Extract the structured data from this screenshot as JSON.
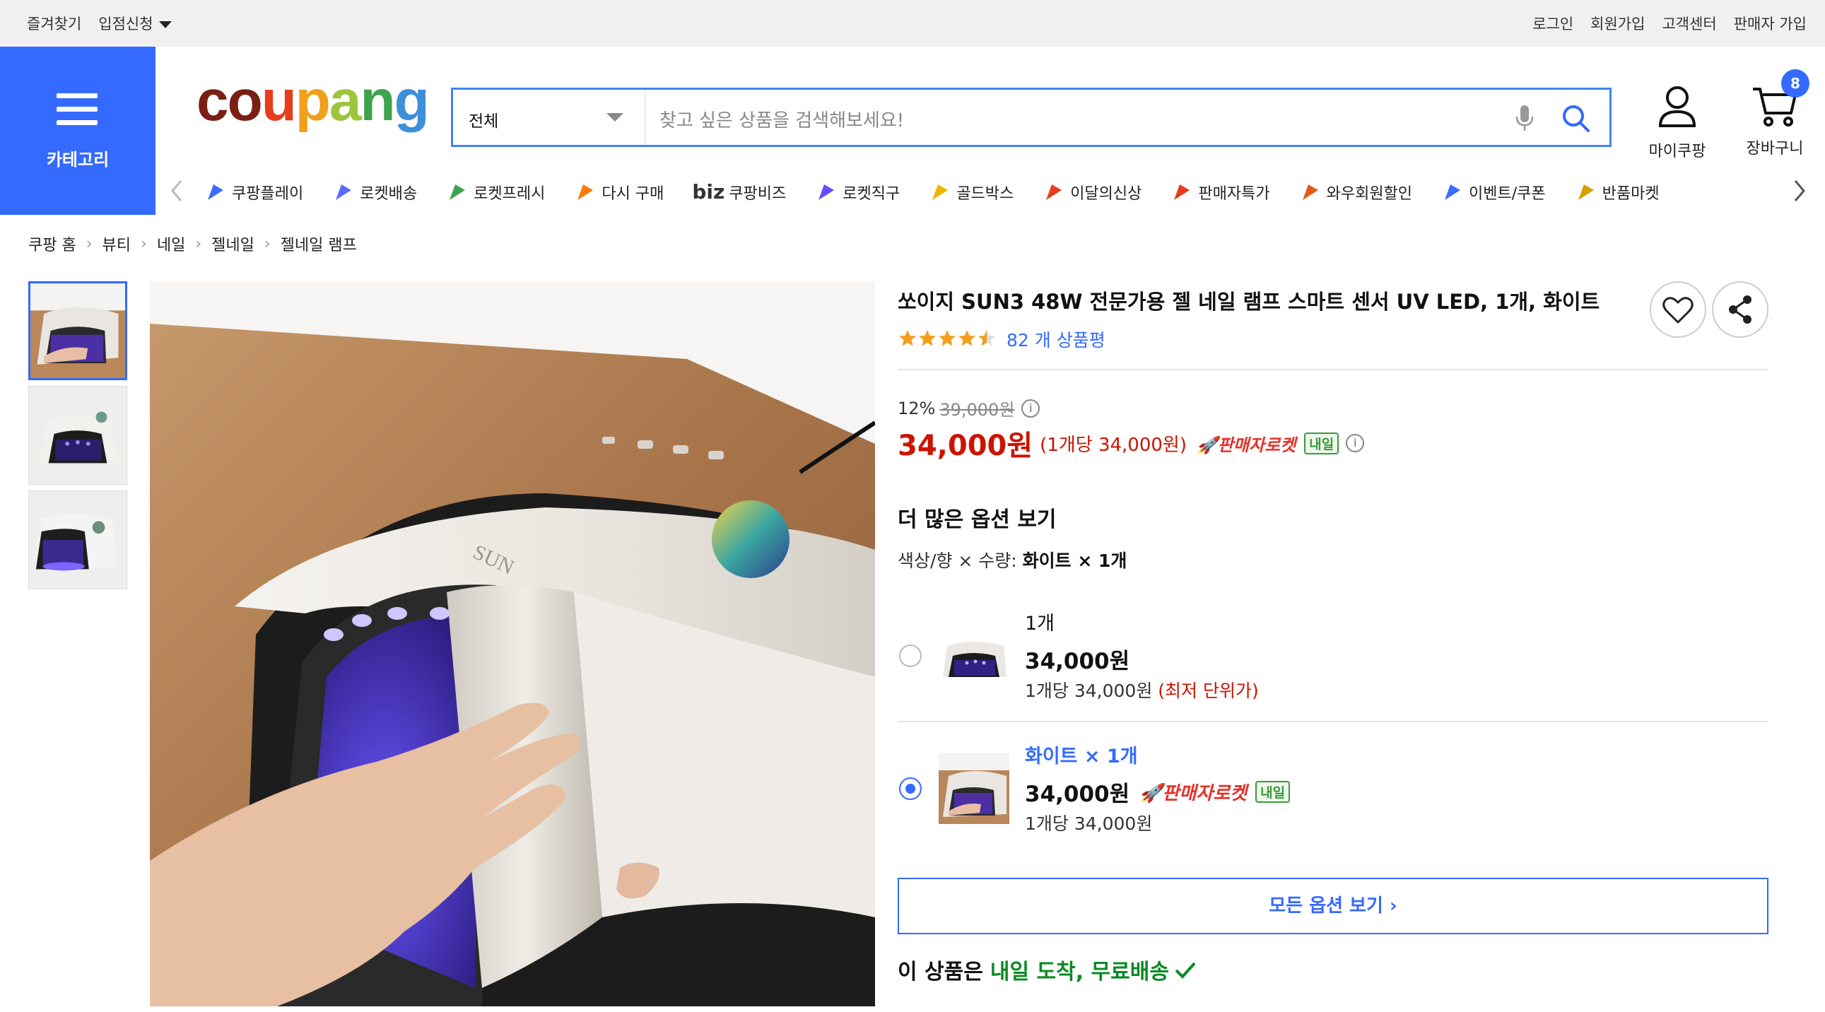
{
  "topbar": {
    "bookmark": "즐겨찾기",
    "seller_apply": "입점신청",
    "login": "로그인",
    "signup": "회원가입",
    "customer_center": "고객센터",
    "seller_signup": "판매자 가입"
  },
  "header": {
    "category_label": "카테고리",
    "logo": "coupang",
    "search_category": "전체",
    "search_placeholder": "찾고 싶은 상품을 검색해보세요!",
    "mycoupang": "마이쿠팡",
    "cart": "장바구니",
    "cart_count": "8"
  },
  "subnav": [
    {
      "label": "쿠팡플레이",
      "icon": "play-icon"
    },
    {
      "label": "로켓배송",
      "icon": "rocket-icon"
    },
    {
      "label": "로켓프레시",
      "icon": "rocket-fresh-icon"
    },
    {
      "label": "다시 구매",
      "icon": "rebuy-icon"
    },
    {
      "label": "쿠팡비즈",
      "icon": "biz-icon",
      "prefix": "biz"
    },
    {
      "label": "로켓직구",
      "icon": "rocket-global-icon"
    },
    {
      "label": "골드박스",
      "icon": "goldbox-icon"
    },
    {
      "label": "이달의신상",
      "icon": "new-bag-icon"
    },
    {
      "label": "판매자특가",
      "icon": "percent-icon"
    },
    {
      "label": "와우회원할인",
      "icon": "wow-icon"
    },
    {
      "label": "이벤트/쿠폰",
      "icon": "coupon-icon"
    },
    {
      "label": "반품마켓",
      "icon": "return-market-icon"
    }
  ],
  "breadcrumb": [
    "쿠팡 홈",
    "뷰티",
    "네일",
    "젤네일",
    "젤네일 램프"
  ],
  "product": {
    "title": "쏘이지 SUN3 48W 전문가용 젤 네일 램프 스마트 센서 UV LED, 1개, 화이트",
    "rating": 4.5,
    "review_count": "82 개 상품평",
    "discount": "12%",
    "original_price": "39,000원",
    "price": "34,000원",
    "unit_price": "(1개당 34,000원)",
    "rocket_label": "판매자로켓",
    "delivery_tag": "내일"
  },
  "options": {
    "title": "더 많은 옵션 보기",
    "selector_label": "색상/향 × 수량: ",
    "selector_value": "화이트 × 1개",
    "items": [
      {
        "name": "1개",
        "price": "34,000원",
        "unit": "1개당 34,000원",
        "note": "(최저 단위가)",
        "selected": false
      },
      {
        "name": "화이트 × 1개",
        "price": "34,000원",
        "unit": "1개당 34,000원",
        "rocket": "판매자로켓",
        "tag": "내일",
        "selected": true
      }
    ],
    "all_button": "모든 옵션 보기"
  },
  "shipping": {
    "prefix": "이 상품은",
    "highlight": "내일 도착, 무료배송"
  },
  "colors": {
    "accent": "#346aff",
    "price_red": "#cb1400",
    "green": "#0a8a23"
  }
}
